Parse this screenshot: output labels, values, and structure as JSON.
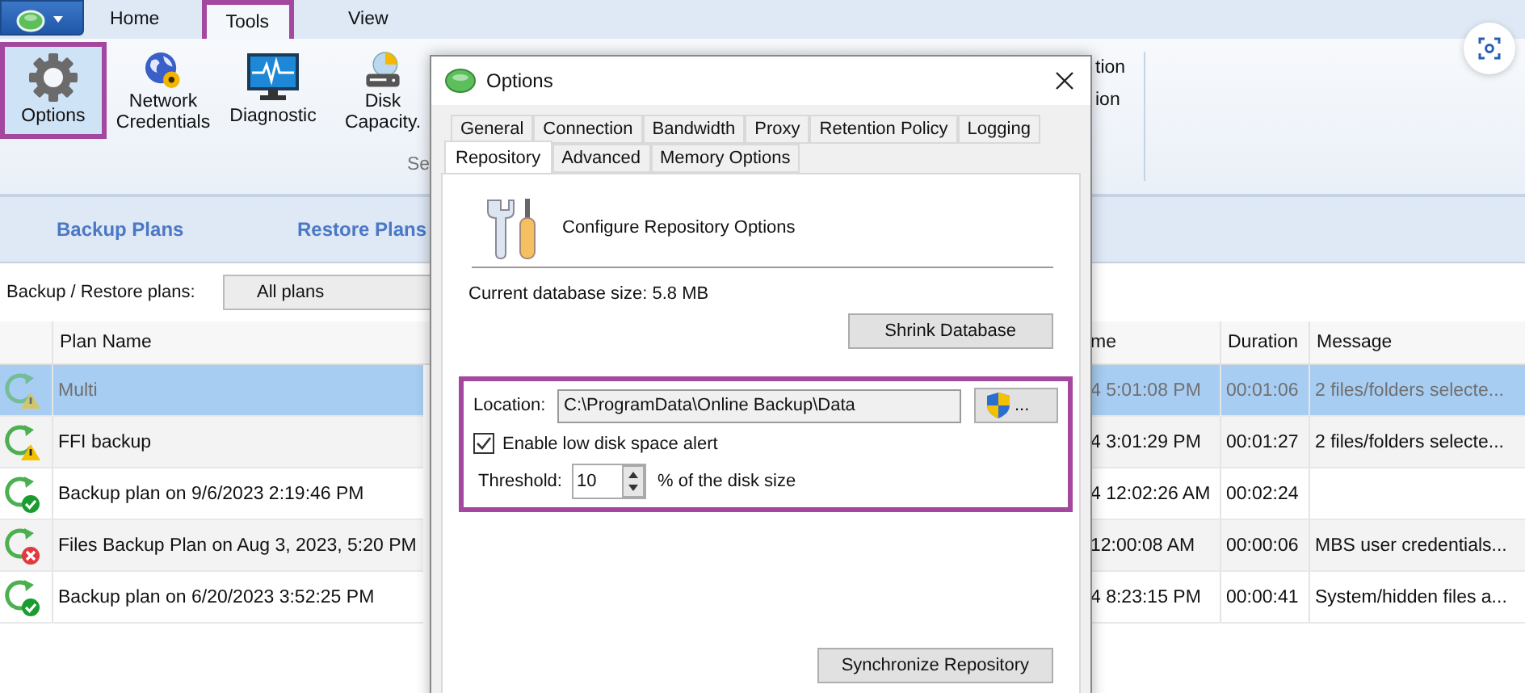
{
  "ribbon_tabs": [
    {
      "label": "Home",
      "selected": false,
      "annotated": false
    },
    {
      "label": "Tools",
      "selected": true,
      "annotated": true
    },
    {
      "label": "View",
      "selected": false,
      "annotated": false
    }
  ],
  "ribbon_buttons": [
    {
      "label": "Options",
      "kind": "gear",
      "annotated": true
    },
    {
      "label": "Network Credentials",
      "kind": "globe",
      "annotated": false
    },
    {
      "label": "Diagnostic",
      "kind": "monitor",
      "annotated": false
    },
    {
      "label": "Disk Capacity.",
      "kind": "disk",
      "annotated": false
    }
  ],
  "ribbon_group_label": "Se",
  "ribbon_fragments": [
    "tion",
    "ion"
  ],
  "subnav": [
    "Backup Plans",
    "Restore Plans"
  ],
  "filter": {
    "label": "Backup / Restore plans:",
    "value": "All plans"
  },
  "table": {
    "columns": [
      "Plan Name",
      "me",
      "Duration",
      "Message"
    ],
    "rows": [
      {
        "kind": "warning",
        "selected": true,
        "name": "Multi",
        "time": "4 5:01:08 PM",
        "duration": "00:01:06",
        "message": "2 files/folders selecte..."
      },
      {
        "kind": "warning",
        "selected": false,
        "name": "FFI backup",
        "time": "4 3:01:29 PM",
        "duration": "00:01:27",
        "message": "2 files/folders selecte..."
      },
      {
        "kind": "success",
        "selected": false,
        "name": "Backup plan on 9/6/2023 2:19:46 PM",
        "time": "4 12:02:26 AM",
        "duration": "00:02:24",
        "message": ""
      },
      {
        "kind": "error",
        "selected": false,
        "name": "Files Backup Plan on Aug 3, 2023, 5:20 PM",
        "time": "12:00:08 AM",
        "duration": "00:00:06",
        "message": "MBS user credentials..."
      },
      {
        "kind": "success",
        "selected": false,
        "name": "Backup plan on 6/20/2023 3:52:25 PM",
        "time": "4 8:23:15 PM",
        "duration": "00:00:41",
        "message": "System/hidden files a..."
      }
    ]
  },
  "dialog": {
    "title": "Options",
    "tab_rows": [
      {
        "tabs": [
          {
            "label": "General",
            "selected": false
          },
          {
            "label": "Connection",
            "selected": false
          },
          {
            "label": "Bandwidth",
            "selected": false
          },
          {
            "label": "Proxy",
            "selected": false
          },
          {
            "label": "Retention Policy",
            "selected": false
          },
          {
            "label": "Logging",
            "selected": false
          }
        ]
      },
      {
        "tabs": [
          {
            "label": "Repository",
            "selected": true
          },
          {
            "label": "Advanced",
            "selected": false
          },
          {
            "label": "Memory Options",
            "selected": false
          }
        ]
      }
    ],
    "header": "Configure Repository Options",
    "db_size": "Current database size: 5.8 MB",
    "shrink_button": "Shrink Database",
    "location_group": {
      "annotated": true,
      "label": "Location:",
      "value": "C:\\ProgramData\\Online Backup\\Data",
      "browse_button": "...",
      "alert": {
        "label": "Enable low disk space alert",
        "checked": true
      },
      "threshold": {
        "label": "Threshold:",
        "value": "10",
        "unit": "% of the disk size"
      }
    },
    "sync_button": "Synchronize Repository"
  }
}
